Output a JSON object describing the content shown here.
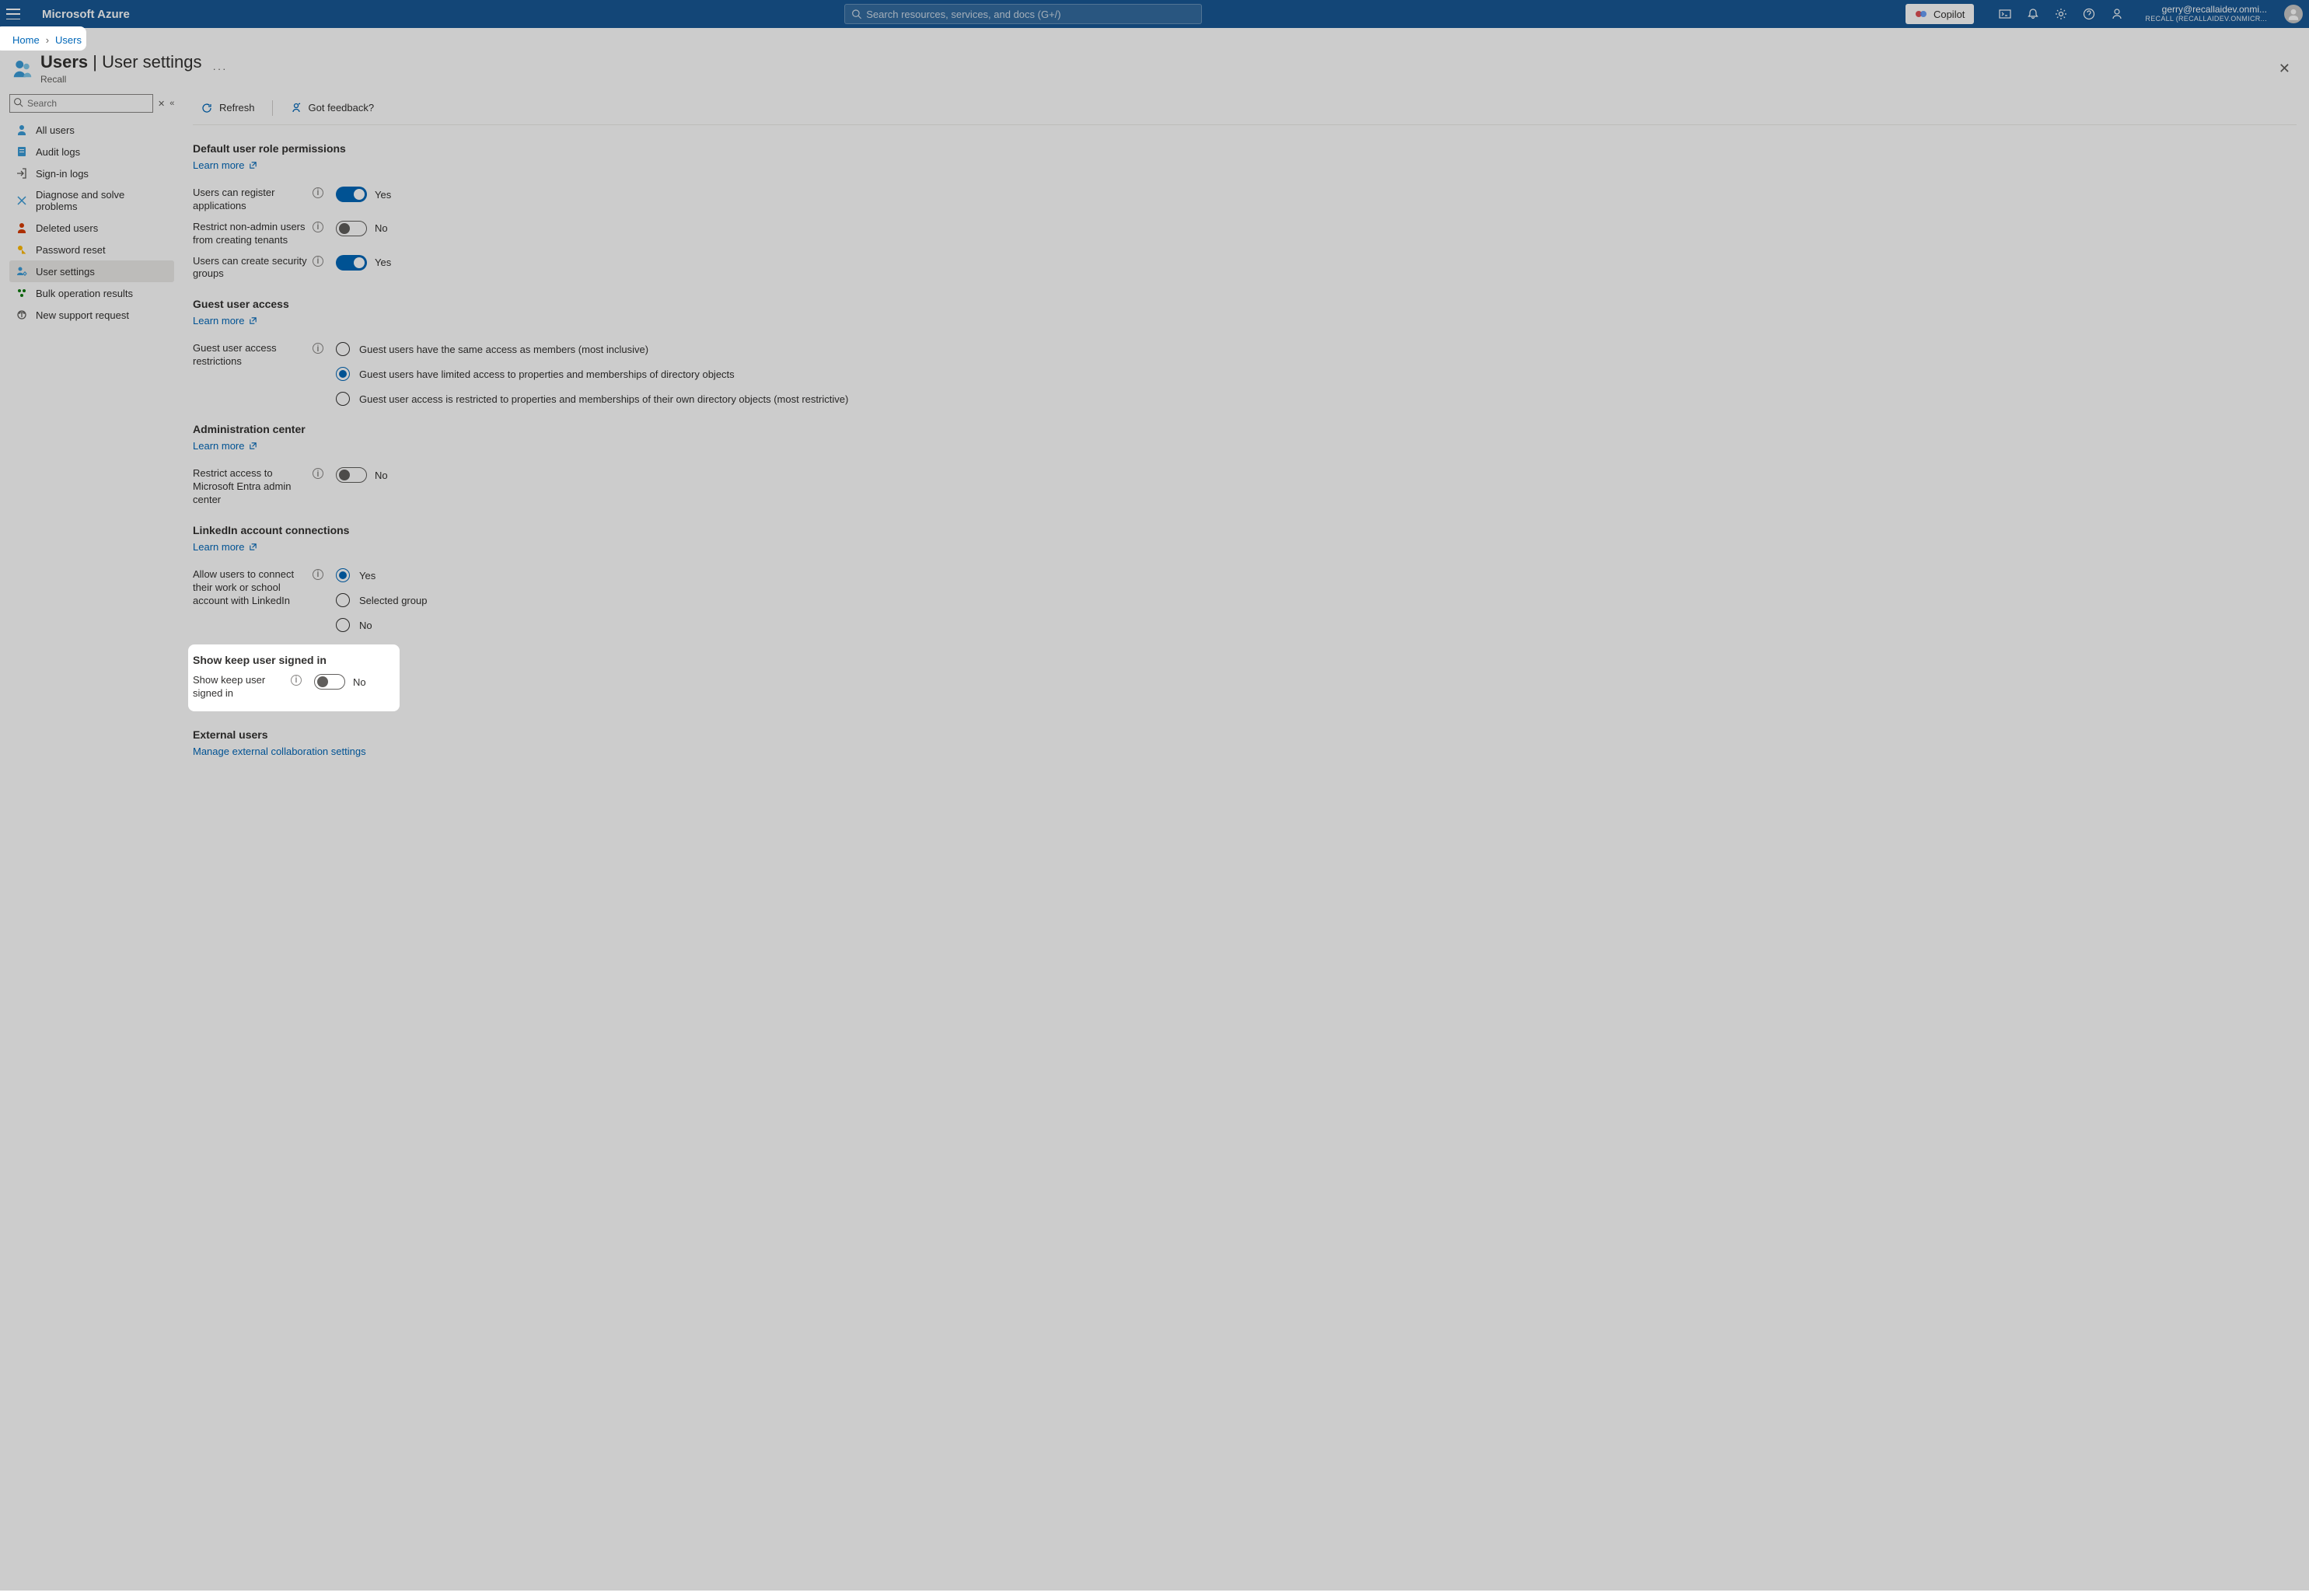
{
  "topbar": {
    "brand": "Microsoft Azure",
    "search_placeholder": "Search resources, services, and docs (G+/)",
    "copilot": "Copilot",
    "account_email": "gerry@recallaidev.onmi...",
    "account_tenant": "RECALL (RECALLAIDEV.ONMICR..."
  },
  "breadcrumb": {
    "home": "Home",
    "users": "Users"
  },
  "header": {
    "title_strong": "Users",
    "title_sep": " | ",
    "title_rest": "User settings",
    "subtitle": "Recall"
  },
  "sidebar": {
    "search_placeholder": "Search",
    "items": [
      {
        "label": "All users"
      },
      {
        "label": "Audit logs"
      },
      {
        "label": "Sign-in logs"
      },
      {
        "label": "Diagnose and solve problems"
      },
      {
        "label": "Deleted users"
      },
      {
        "label": "Password reset"
      },
      {
        "label": "User settings"
      },
      {
        "label": "Bulk operation results"
      },
      {
        "label": "New support request"
      }
    ]
  },
  "toolbar": {
    "refresh": "Refresh",
    "feedback": "Got feedback?"
  },
  "sections": {
    "default_perms": {
      "title": "Default user role permissions",
      "learn": "Learn more",
      "register_apps": {
        "label": "Users can register applications",
        "value": "Yes"
      },
      "restrict_tenants": {
        "label": "Restrict non-admin users from creating tenants",
        "value": "No"
      },
      "create_groups": {
        "label": "Users can create security groups",
        "value": "Yes"
      }
    },
    "guest": {
      "title": "Guest user access",
      "learn": "Learn more",
      "label": "Guest user access restrictions",
      "opts": [
        "Guest users have the same access as members (most inclusive)",
        "Guest users have limited access to properties and memberships of directory objects",
        "Guest user access is restricted to properties and memberships of their own directory objects (most restrictive)"
      ]
    },
    "admin": {
      "title": "Administration center",
      "learn": "Learn more",
      "restrict": {
        "label": "Restrict access to Microsoft Entra admin center",
        "value": "No"
      }
    },
    "linkedin": {
      "title": "LinkedIn account connections",
      "learn": "Learn more",
      "label": "Allow users to connect their work or school account with LinkedIn",
      "opts": [
        "Yes",
        "Selected group",
        "No"
      ]
    },
    "keep": {
      "title": "Show keep user signed in",
      "label": "Show keep user signed in",
      "value": "No"
    },
    "external": {
      "title": "External users",
      "link": "Manage external collaboration settings"
    }
  }
}
